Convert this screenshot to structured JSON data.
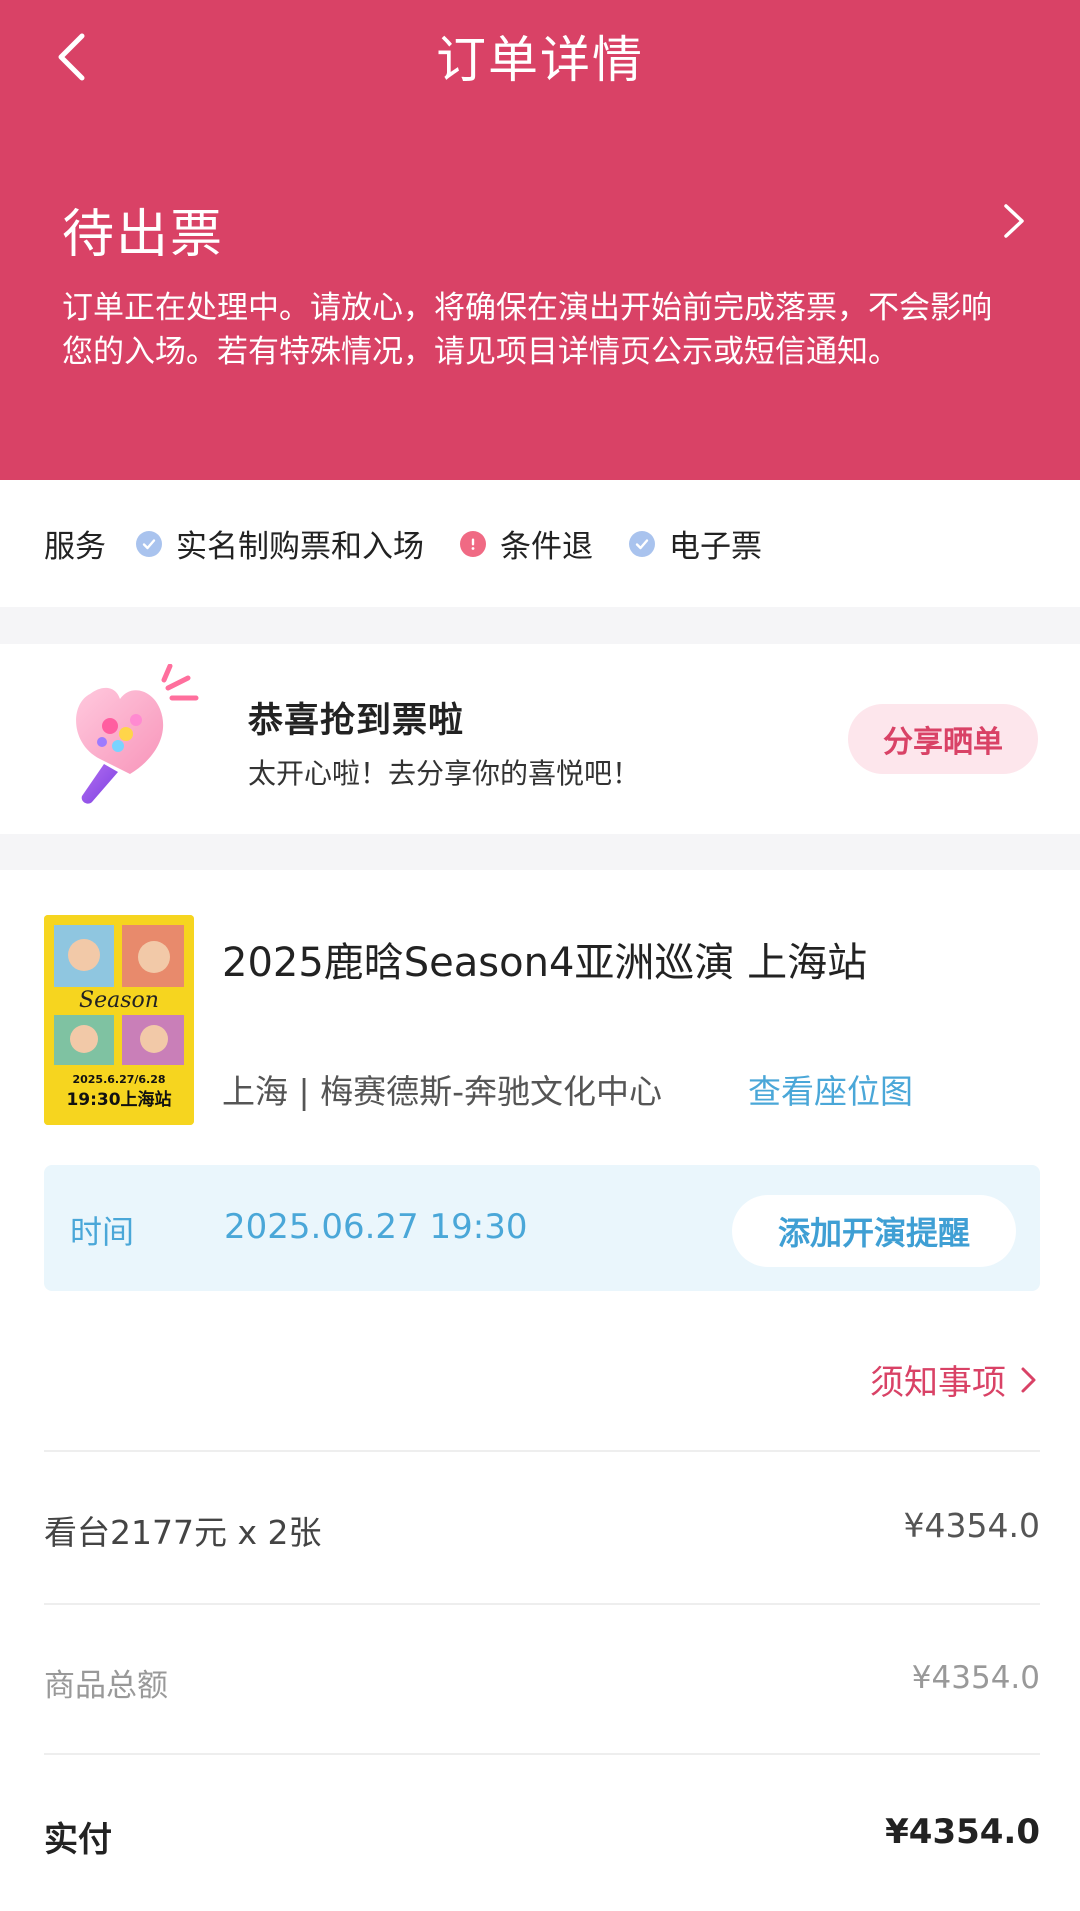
{
  "nav": {
    "title": "订单详情"
  },
  "status": {
    "title": "待出票",
    "notice": "订单正在处理中。请放心，将确保在演出开始前完成落票，不会影响您的入场。若有特殊情况，请见项目详情页公示或短信通知。"
  },
  "services": {
    "label": "服务",
    "items": [
      {
        "label": "实名制购票和入场",
        "icon": "check-circle-icon",
        "color": "#a9c3ee"
      },
      {
        "label": "条件退",
        "icon": "alert-circle-icon",
        "color": "#f06a84"
      },
      {
        "label": "电子票",
        "icon": "check-circle-icon",
        "color": "#a9c3ee"
      }
    ]
  },
  "congrats": {
    "title": "恭喜抢到票啦",
    "subtitle": "太开心啦！去分享你的喜悦吧！",
    "share_label": "分享晒单"
  },
  "event": {
    "title": "2025鹿晗Season4亚洲巡演 上海站",
    "venue": "上海 | 梅赛德斯-奔驰文化中心",
    "seat_map_label": "查看座位图",
    "poster_text": {
      "title": "Season",
      "date": "2025.6.27/6.28",
      "time_city": "19:30上海站"
    },
    "time_label": "时间",
    "time_value": "2025.06.27 19:30",
    "remind_label": "添加开演提醒",
    "notes_label": "须知事项"
  },
  "pricing": {
    "ticket_line": "看台2177元 x 2张",
    "ticket_amount": "¥4354.0",
    "subtotal_label": "商品总额",
    "subtotal_amount": "¥4354.0",
    "paid_label": "实付",
    "paid_amount": "¥4354.0"
  },
  "colors": {
    "brand": "#d94266",
    "link": "#4aa7d8",
    "time_bg": "#eaf6fc"
  }
}
